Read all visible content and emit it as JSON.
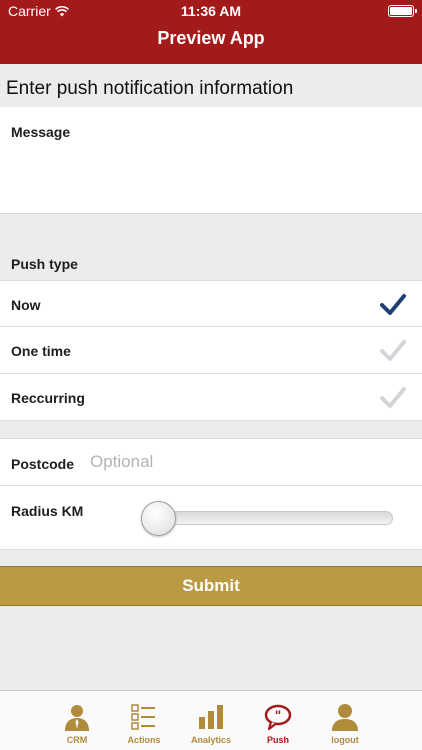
{
  "status_bar": {
    "carrier": "Carrier",
    "time": "11:36 AM"
  },
  "nav": {
    "title": "Preview App"
  },
  "form": {
    "heading": "Enter push notification information",
    "message_label": "Message",
    "message_value": "",
    "push_type_label": "Push type",
    "push_types": [
      {
        "label": "Now",
        "selected": true
      },
      {
        "label": "One time",
        "selected": false
      },
      {
        "label": "Reccurring",
        "selected": false
      }
    ],
    "postcode_label": "Postcode",
    "postcode_placeholder": "Optional",
    "postcode_value": "",
    "radius_label": "Radius KM",
    "radius_value_fraction": 0,
    "submit_label": "Submit"
  },
  "tabbar": {
    "items": [
      {
        "label": "CRM",
        "icon": "person-icon",
        "active": false
      },
      {
        "label": "Actions",
        "icon": "checklist-icon",
        "active": false
      },
      {
        "label": "Analytics",
        "icon": "bar-chart-icon",
        "active": false
      },
      {
        "label": "Push",
        "icon": "speech-bubble-icon",
        "active": true
      },
      {
        "label": "logout",
        "icon": "logout-person-icon",
        "active": false
      }
    ]
  },
  "colors": {
    "brand_red": "#a31a1a",
    "gold": "#bb9a44",
    "check_selected": "#1f3f72",
    "check_unselected": "#d4d4d8"
  }
}
